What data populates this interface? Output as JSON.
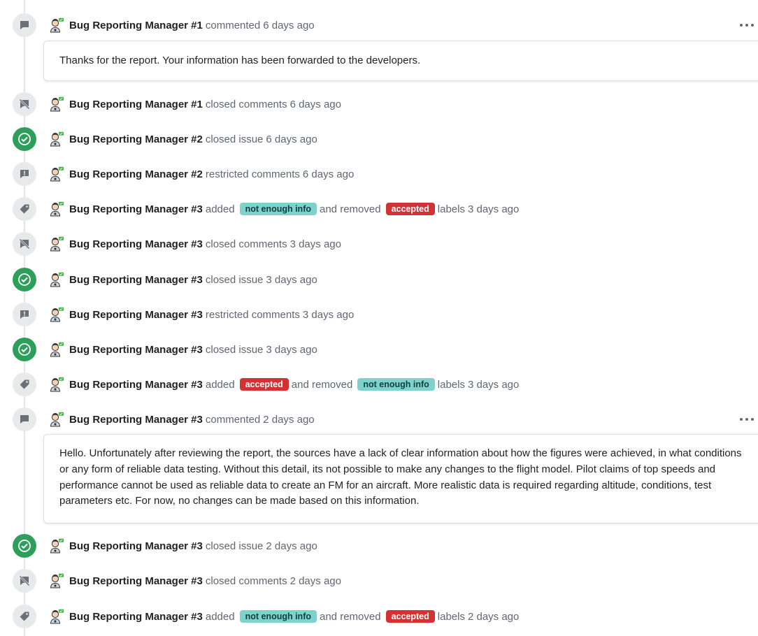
{
  "events": [
    {
      "kind": "comment",
      "icon": "comment-icon",
      "actor": "Bug Reporting Manager #1",
      "action": "commented",
      "time": "6 days ago",
      "body": "Thanks for the report. Your information has been forwarded to the developers."
    },
    {
      "kind": "event",
      "icon": "comments-closed-icon",
      "actor": "Bug Reporting Manager #1",
      "action": "closed comments",
      "time": "6 days ago"
    },
    {
      "kind": "event",
      "icon": "issue-closed-icon",
      "actor": "Bug Reporting Manager #2",
      "action": "closed issue",
      "time": "6 days ago"
    },
    {
      "kind": "event",
      "icon": "comments-restricted-icon",
      "actor": "Bug Reporting Manager #2",
      "action": "restricted comments",
      "time": "6 days ago"
    },
    {
      "kind": "labels",
      "icon": "label-icon",
      "actor": "Bug Reporting Manager #3",
      "added_word": "added",
      "added_label": "not enough info",
      "removed_word": "and removed",
      "removed_label": "accepted",
      "labels_word": "labels",
      "time": "3 days ago"
    },
    {
      "kind": "event",
      "icon": "comments-closed-icon",
      "actor": "Bug Reporting Manager #3",
      "action": "closed comments",
      "time": "3 days ago"
    },
    {
      "kind": "event",
      "icon": "issue-closed-icon",
      "actor": "Bug Reporting Manager #3",
      "action": "closed issue",
      "time": "3 days ago"
    },
    {
      "kind": "event",
      "icon": "comments-restricted-icon",
      "actor": "Bug Reporting Manager #3",
      "action": "restricted comments",
      "time": "3 days ago"
    },
    {
      "kind": "event",
      "icon": "issue-closed-icon",
      "actor": "Bug Reporting Manager #3",
      "action": "closed issue",
      "time": "3 days ago"
    },
    {
      "kind": "labels",
      "icon": "label-icon",
      "actor": "Bug Reporting Manager #3",
      "added_word": "added",
      "added_label": "accepted",
      "removed_word": "and removed",
      "removed_label": "not enough info",
      "labels_word": "labels",
      "time": "3 days ago"
    },
    {
      "kind": "comment",
      "icon": "comment-icon",
      "actor": "Bug Reporting Manager #3",
      "action": "commented",
      "time": "2 days ago",
      "body": "Hello. Unfortunately after reviewing the report, the sources have a lack of clear information about how the figures were achieved, in what conditions or any form of reliable data testing. Without this detail, its not possible to make any changes to the flight model. Pilot claims of top speeds and performance cannot be used as reliable data to create an FM for an aircraft. More realistic data is required regarding altitude, conditions, test parameters etc. For now, no changes can be made based on this information."
    },
    {
      "kind": "event",
      "icon": "issue-closed-icon",
      "actor": "Bug Reporting Manager #3",
      "action": "closed issue",
      "time": "2 days ago"
    },
    {
      "kind": "event",
      "icon": "comments-closed-icon",
      "actor": "Bug Reporting Manager #3",
      "action": "closed comments",
      "time": "2 days ago"
    },
    {
      "kind": "labels",
      "icon": "label-icon",
      "actor": "Bug Reporting Manager #3",
      "added_word": "added",
      "added_label": "not enough info",
      "removed_word": "and removed",
      "removed_label": "accepted",
      "labels_word": "labels",
      "time": "2 days ago"
    }
  ],
  "label_colors": {
    "not enough info": "#7dd3cc",
    "accepted": "#d43232"
  },
  "colors": {
    "closed_issue": "#2e9e5b",
    "neutral_icon_bg": "#e8e9eb",
    "icon_glyph": "#6b7078"
  }
}
